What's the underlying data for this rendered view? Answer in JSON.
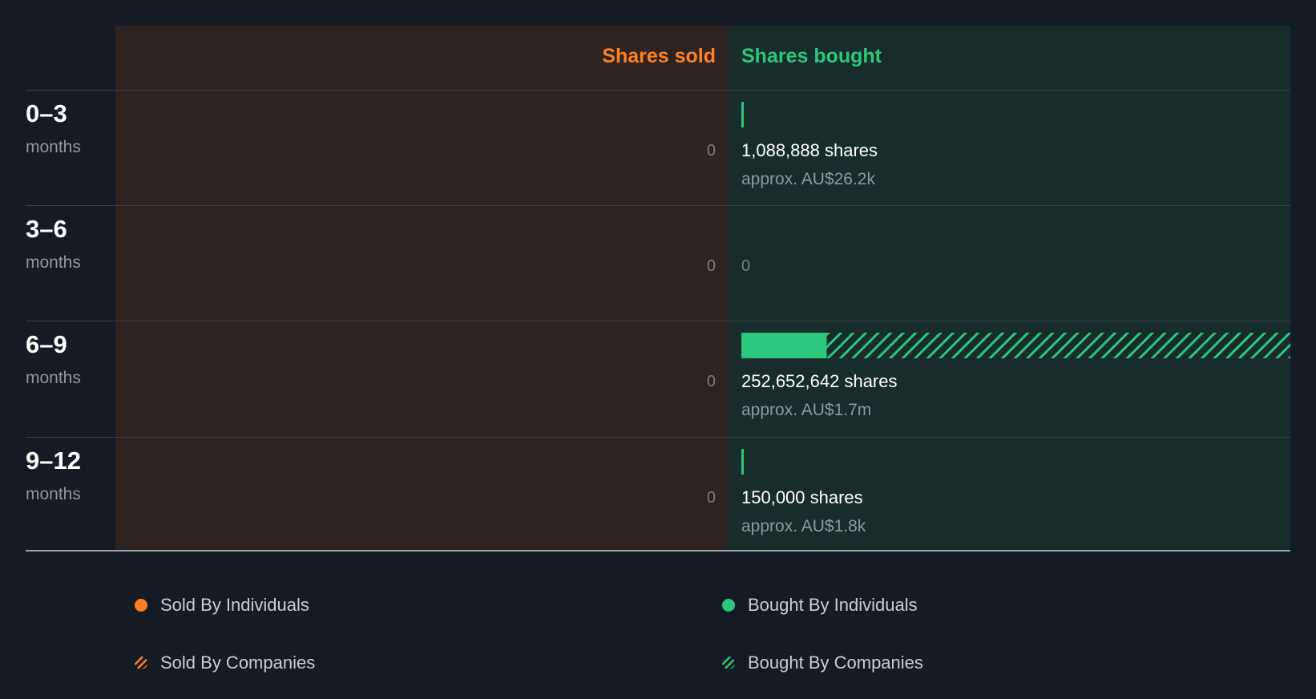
{
  "colors": {
    "sold": "#ff7f21",
    "bought": "#2bc77c",
    "text": "#ffffff",
    "muted": "#8e979e"
  },
  "header": {
    "sold": "Shares sold",
    "bought": "Shares bought"
  },
  "chart_data": {
    "type": "bar",
    "categories": [
      "0–3 months",
      "3–6 months",
      "6–9 months",
      "9–12 months"
    ],
    "series": [
      {
        "name": "Sold By Individuals",
        "values": [
          0,
          0,
          0,
          0
        ]
      },
      {
        "name": "Sold By Companies",
        "values": [
          0,
          0,
          0,
          0
        ]
      },
      {
        "name": "Bought By Individuals",
        "values": [
          1088888,
          0,
          39300000,
          150000
        ]
      },
      {
        "name": "Bought By Companies",
        "values": [
          0,
          0,
          213352642,
          0
        ]
      }
    ],
    "xlim": [
      0,
      252652642
    ]
  },
  "rows": [
    {
      "range": "0–3",
      "unit": "months",
      "sold": "0",
      "bought_shares": "1,088,888 shares",
      "bought_approx": "approx. AU$26.2k"
    },
    {
      "range": "3–6",
      "unit": "months",
      "sold": "0",
      "bought_zero": "0"
    },
    {
      "range": "6–9",
      "unit": "months",
      "sold": "0",
      "bought_shares": "252,652,642 shares",
      "bought_approx": "approx. AU$1.7m"
    },
    {
      "range": "9–12",
      "unit": "months",
      "sold": "0",
      "bought_shares": "150,000 shares",
      "bought_approx": "approx. AU$1.8k"
    }
  ],
  "legend": [
    {
      "label": "Sold By Individuals",
      "icon": "solid-dot-icon",
      "color": "#ff7f21"
    },
    {
      "label": "Bought By Individuals",
      "icon": "solid-dot-icon",
      "color": "#2bc77c"
    },
    {
      "label": "Sold By Companies",
      "icon": "hatched-dot-icon",
      "color": "#ff7f21"
    },
    {
      "label": "Bought By Companies",
      "icon": "hatched-dot-icon",
      "color": "#2bc77c"
    }
  ]
}
